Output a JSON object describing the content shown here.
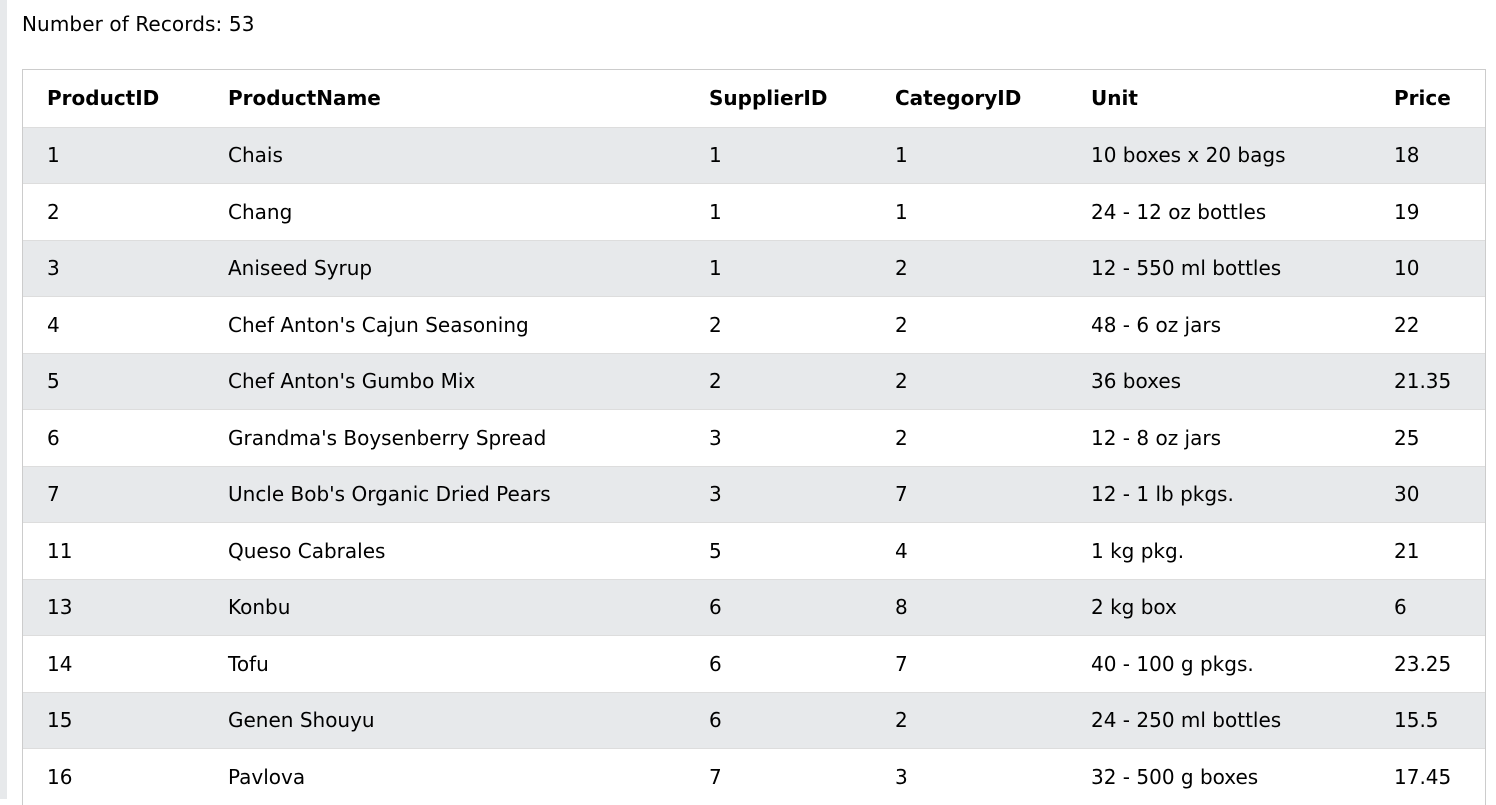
{
  "header": {
    "records_label": "Number of Records:",
    "records_count": "53"
  },
  "table": {
    "columns": [
      "ProductID",
      "ProductName",
      "SupplierID",
      "CategoryID",
      "Unit",
      "Price"
    ],
    "rows": [
      [
        "1",
        "Chais",
        "1",
        "1",
        "10 boxes x 20 bags",
        "18"
      ],
      [
        "2",
        "Chang",
        "1",
        "1",
        "24 - 12 oz bottles",
        "19"
      ],
      [
        "3",
        "Aniseed Syrup",
        "1",
        "2",
        "12 - 550 ml bottles",
        "10"
      ],
      [
        "4",
        "Chef Anton's Cajun Seasoning",
        "2",
        "2",
        "48 - 6 oz jars",
        "22"
      ],
      [
        "5",
        "Chef Anton's Gumbo Mix",
        "2",
        "2",
        "36 boxes",
        "21.35"
      ],
      [
        "6",
        "Grandma's Boysenberry Spread",
        "3",
        "2",
        "12 - 8 oz jars",
        "25"
      ],
      [
        "7",
        "Uncle Bob's Organic Dried Pears",
        "3",
        "7",
        "12 - 1 lb pkgs.",
        "30"
      ],
      [
        "11",
        "Queso Cabrales",
        "5",
        "4",
        "1 kg pkg.",
        "21"
      ],
      [
        "13",
        "Konbu",
        "6",
        "8",
        "2 kg box",
        "6"
      ],
      [
        "14",
        "Tofu",
        "6",
        "7",
        "40 - 100 g pkgs.",
        "23.25"
      ],
      [
        "15",
        "Genen Shouyu",
        "6",
        "2",
        "24 - 250 ml bottles",
        "15.5"
      ],
      [
        "16",
        "Pavlova",
        "7",
        "3",
        "32 - 500 g boxes",
        "17.45"
      ]
    ]
  },
  "colors": {
    "stripe": "#e7e9eb",
    "border": "#cccccc",
    "row_divider": "#dddddd"
  }
}
